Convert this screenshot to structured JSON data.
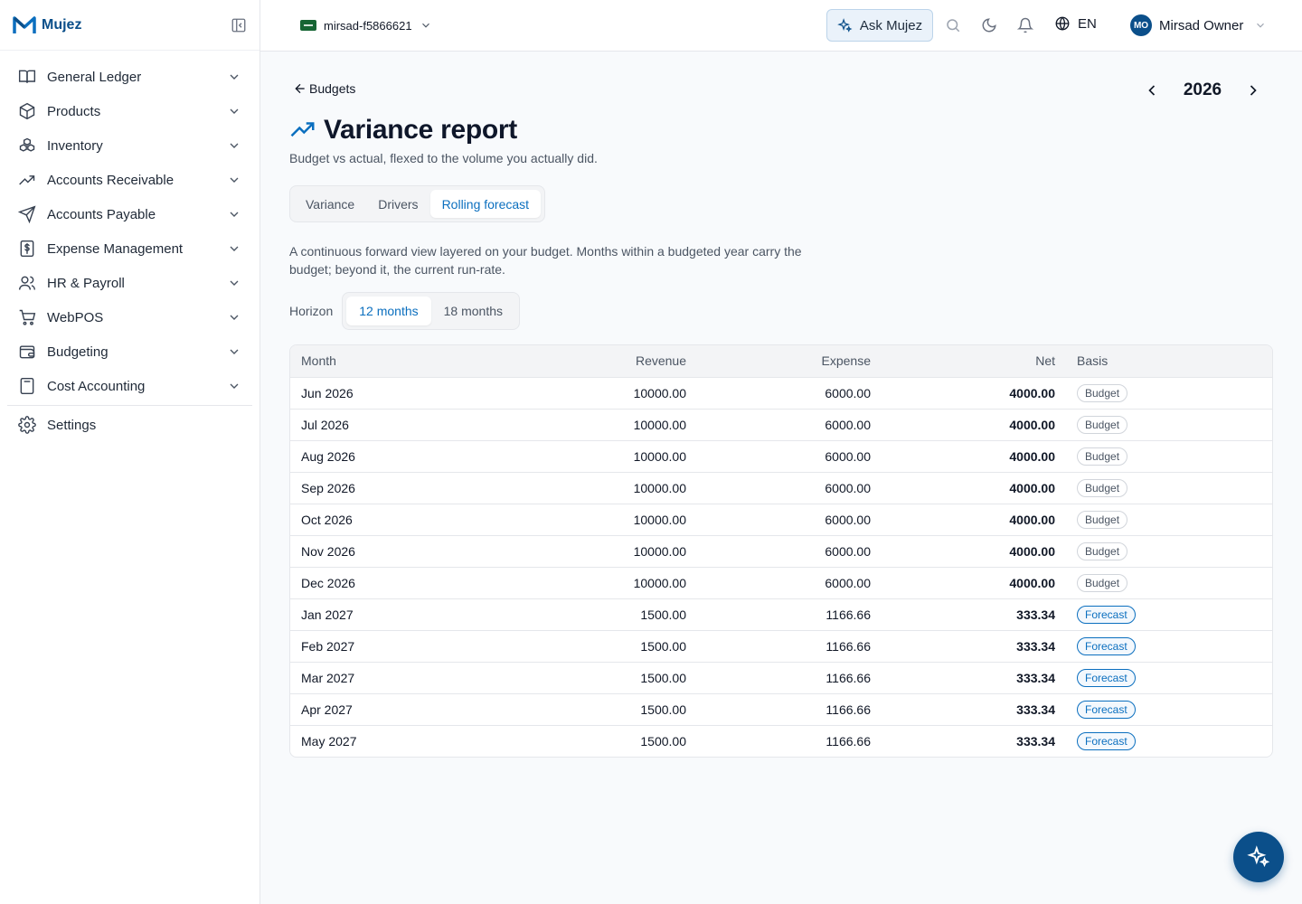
{
  "brand": {
    "name": "Mujez"
  },
  "sidebar": {
    "items": [
      {
        "label": "General Ledger",
        "icon": "book-open-icon"
      },
      {
        "label": "Products",
        "icon": "box-icon"
      },
      {
        "label": "Inventory",
        "icon": "boxes-icon"
      },
      {
        "label": "Accounts Receivable",
        "icon": "trending-up-icon"
      },
      {
        "label": "Accounts Payable",
        "icon": "send-icon"
      },
      {
        "label": "Expense Management",
        "icon": "receipt-dollar-icon"
      },
      {
        "label": "HR & Payroll",
        "icon": "users-icon"
      },
      {
        "label": "WebPOS",
        "icon": "cart-icon"
      },
      {
        "label": "Budgeting",
        "icon": "wallet-icon"
      },
      {
        "label": "Cost Accounting",
        "icon": "calculator-icon"
      }
    ],
    "settings_label": "Settings"
  },
  "topbar": {
    "tenant": "mirsad-f5866621",
    "ask_label": "Ask Mujez",
    "language": "EN",
    "user_initials": "MO",
    "user_name": "Mirsad Owner"
  },
  "page": {
    "back_label": "Budgets",
    "year": "2026",
    "title": "Variance report",
    "subtitle": "Budget vs actual, flexed to the volume you actually did.",
    "tabs": [
      "Variance",
      "Drivers",
      "Rolling forecast"
    ],
    "active_tab": "Rolling forecast",
    "description": "A continuous forward view layered on your budget. Months within a budgeted year carry the budget; beyond it, the current run-rate.",
    "horizon_label": "Horizon",
    "horizon_options": [
      "12 months",
      "18 months"
    ],
    "horizon_selected": "12 months"
  },
  "table": {
    "columns": [
      "Month",
      "Revenue",
      "Expense",
      "Net",
      "Basis"
    ],
    "rows": [
      {
        "month": "Jun 2026",
        "revenue": "10000.00",
        "expense": "6000.00",
        "net": "4000.00",
        "basis": "Budget"
      },
      {
        "month": "Jul 2026",
        "revenue": "10000.00",
        "expense": "6000.00",
        "net": "4000.00",
        "basis": "Budget"
      },
      {
        "month": "Aug 2026",
        "revenue": "10000.00",
        "expense": "6000.00",
        "net": "4000.00",
        "basis": "Budget"
      },
      {
        "month": "Sep 2026",
        "revenue": "10000.00",
        "expense": "6000.00",
        "net": "4000.00",
        "basis": "Budget"
      },
      {
        "month": "Oct 2026",
        "revenue": "10000.00",
        "expense": "6000.00",
        "net": "4000.00",
        "basis": "Budget"
      },
      {
        "month": "Nov 2026",
        "revenue": "10000.00",
        "expense": "6000.00",
        "net": "4000.00",
        "basis": "Budget"
      },
      {
        "month": "Dec 2026",
        "revenue": "10000.00",
        "expense": "6000.00",
        "net": "4000.00",
        "basis": "Budget"
      },
      {
        "month": "Jan 2027",
        "revenue": "1500.00",
        "expense": "1166.66",
        "net": "333.34",
        "basis": "Forecast"
      },
      {
        "month": "Feb 2027",
        "revenue": "1500.00",
        "expense": "1166.66",
        "net": "333.34",
        "basis": "Forecast"
      },
      {
        "month": "Mar 2027",
        "revenue": "1500.00",
        "expense": "1166.66",
        "net": "333.34",
        "basis": "Forecast"
      },
      {
        "month": "Apr 2027",
        "revenue": "1500.00",
        "expense": "1166.66",
        "net": "333.34",
        "basis": "Forecast"
      },
      {
        "month": "May 2027",
        "revenue": "1500.00",
        "expense": "1166.66",
        "net": "333.34",
        "basis": "Forecast"
      }
    ]
  },
  "colors": {
    "brand": "#0b4f8a",
    "accent": "#0b6fbf",
    "forecast": "#0b6fbf"
  }
}
